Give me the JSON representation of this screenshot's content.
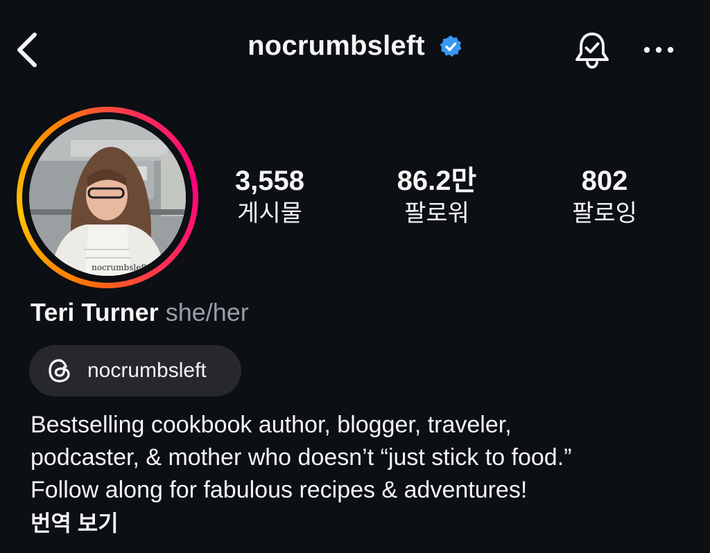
{
  "header": {
    "username": "nocrumbsleft",
    "verified": true,
    "back_icon": "chevron-left-icon",
    "notification_icon": "bell-check-icon",
    "more_icon": "more-horizontal-icon"
  },
  "profile": {
    "avatar": "profile-photo",
    "avatar_shirt_text": "nocrumbsleft",
    "stats": [
      {
        "value": "3,558",
        "label": "게시물"
      },
      {
        "value": "86.2만",
        "label": "팔로워"
      },
      {
        "value": "802",
        "label": "팔로잉"
      }
    ],
    "name": "Teri Turner",
    "pronouns": "she/her",
    "threads_label": "nocrumbsleft",
    "bio_lines": [
      "Bestselling cookbook author, blogger, traveler,",
      "podcaster, & mother who doesn’t “just stick to food.”",
      "Follow along for fabulous recipes & adventures!"
    ],
    "translate_label": "번역 보기"
  },
  "colors": {
    "background": "#0c0f14",
    "verified_blue": "#3897f0",
    "chip_bg": "#26282d",
    "pronoun_gray": "#9a9ea8"
  }
}
